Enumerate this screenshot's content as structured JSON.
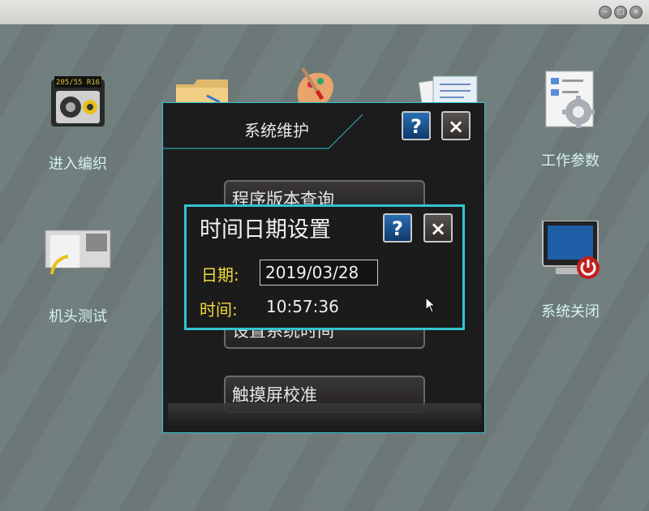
{
  "window": {
    "buttons": [
      "−",
      "□",
      "×"
    ]
  },
  "desktop": {
    "icons": [
      {
        "label": "进入编织",
        "icon": "knitting-machine-icon"
      },
      {
        "label": "",
        "icon": "folder-icon"
      },
      {
        "label": "",
        "icon": "palette-icon"
      },
      {
        "label": "",
        "icon": "documents-icon"
      },
      {
        "label": "工作参数",
        "icon": "settings-gear-icon"
      },
      {
        "label": "机头测试",
        "icon": "machine-head-icon"
      },
      {
        "label": "系统关闭",
        "icon": "shutdown-monitor-icon"
      }
    ],
    "lcd_text": "205/55 R16"
  },
  "system_dialog": {
    "title": "系统维护",
    "help": "?",
    "close": "×",
    "items": [
      "程序版本查询",
      "设置系统时间",
      "触摸屏校准"
    ]
  },
  "time_dialog": {
    "title": "时间日期设置",
    "help": "?",
    "close": "×",
    "date_label": "日期:",
    "date_value": "2019/03/28",
    "time_label": "时间:",
    "time_value": "10:57:36"
  },
  "colors": {
    "desktop_bg": "#6f7c7c",
    "dialog_border": "#33c4cf",
    "label_yellow": "#f1d93a",
    "icon_label": "#d4f4ee"
  }
}
